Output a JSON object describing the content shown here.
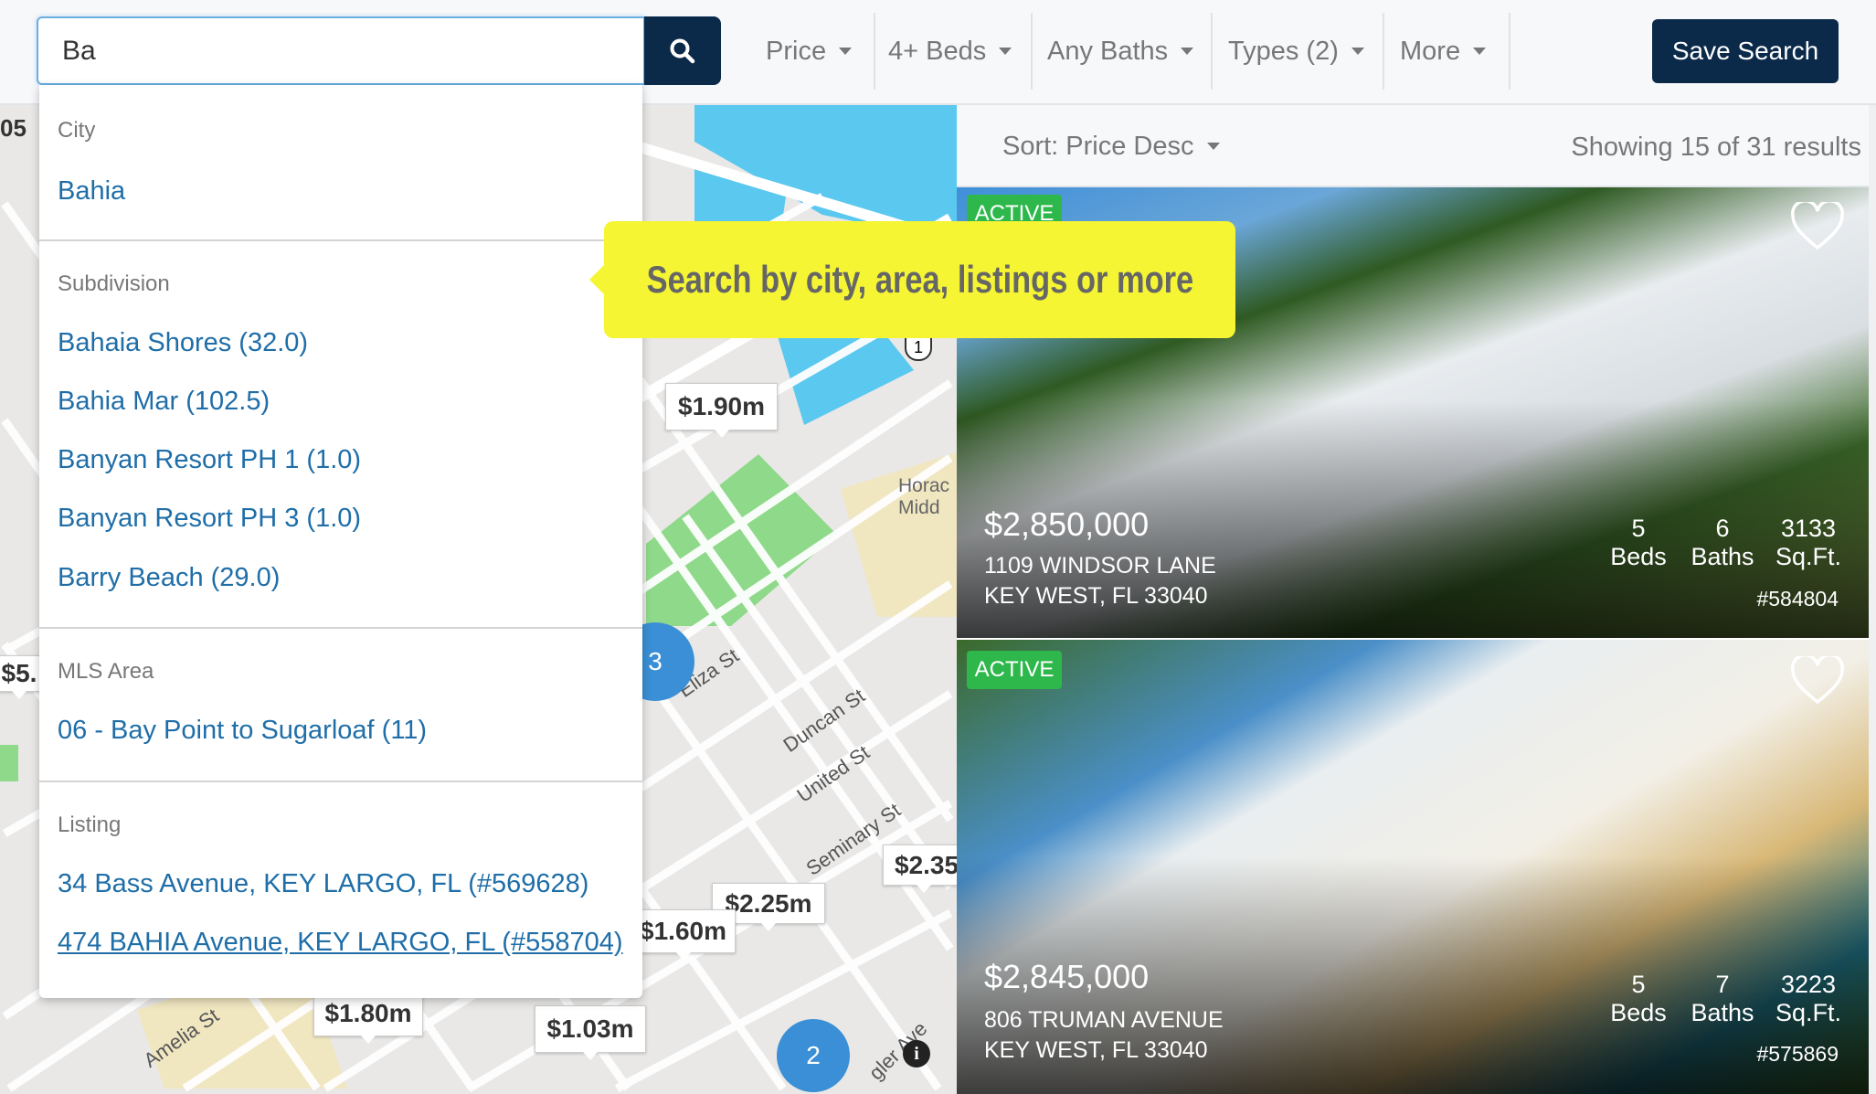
{
  "search": {
    "value": "Ba",
    "icon": "search-icon"
  },
  "filters": [
    {
      "label": "Price"
    },
    {
      "label": "4+ Beds"
    },
    {
      "label": "Any Baths"
    },
    {
      "label": "Types (2)"
    },
    {
      "label": "More"
    }
  ],
  "save_search": "Save Search",
  "sort": {
    "label": "Sort: Price Desc",
    "results": "Showing 15 of 31 results"
  },
  "tooltip": "Search by city, area, listings or more",
  "dropdown": {
    "city": {
      "header": "City",
      "items": [
        "Bahia"
      ]
    },
    "subdivision": {
      "header": "Subdivision",
      "items": [
        "Bahaia Shores (32.0)",
        "Bahia Mar (102.5)",
        "Banyan Resort PH 1 (1.0)",
        "Banyan Resort PH 3 (1.0)",
        "Barry Beach (29.0)"
      ]
    },
    "mls_area": {
      "header": "MLS Area",
      "items": [
        "06 - Bay Point to Sugarloaf (11)"
      ]
    },
    "listing": {
      "header": "Listing",
      "items": [
        "34 Bass Avenue, KEY LARGO, FL (#569628)",
        "474 BAHIA Avenue, KEY LARGO, FL (#558704)"
      ]
    }
  },
  "map": {
    "markers": [
      "$1.90m",
      "$2.25m",
      "$1.60m",
      "$2.35",
      "$1.80m",
      "$1.03m",
      "$5."
    ],
    "clusters": [
      "3",
      "2"
    ],
    "streets": [
      "Eliza St",
      "Duncan St",
      "United St",
      "Seminary St",
      "Amelia St",
      "gler Ave"
    ],
    "labels": [
      "Horac",
      "Midd",
      "05"
    ],
    "route_shield": "1"
  },
  "listings": [
    {
      "status": "ACTIVE",
      "price": "$2,850,000",
      "address": "1109 WINDSOR LANE",
      "city": "KEY WEST, FL 33040",
      "beds": "5",
      "baths": "6",
      "sqft": "3133",
      "beds_label": "Beds",
      "baths_label": "Baths",
      "sqft_label": "Sq.Ft.",
      "mls": "#584804"
    },
    {
      "status": "ACTIVE",
      "price": "$2,845,000",
      "address": "806 TRUMAN AVENUE",
      "city": "KEY WEST, FL 33040",
      "beds": "5",
      "baths": "7",
      "sqft": "3223",
      "beds_label": "Beds",
      "baths_label": "Baths",
      "sqft_label": "Sq.Ft.",
      "mls": "#575869"
    }
  ],
  "colors": {
    "navy": "#0b2a4a",
    "link": "#1f6ea8",
    "active": "#2eb84c",
    "tooltip": "#f5f534",
    "cluster": "#3a8fd6"
  }
}
